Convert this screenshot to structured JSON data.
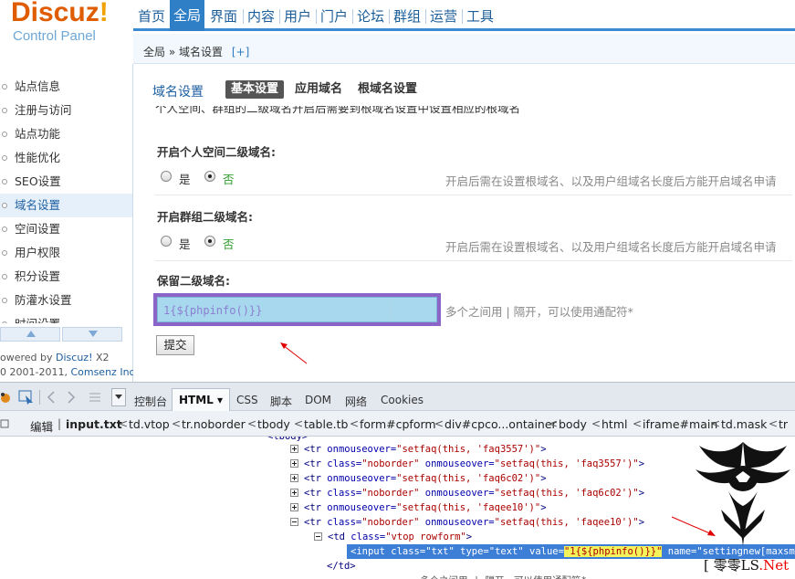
{
  "brand": {
    "logo": "Discuz",
    "logo_mark": "!",
    "subtitle": "Control Panel"
  },
  "topnav": {
    "items": [
      {
        "label": "首页",
        "active": false
      },
      {
        "label": "全局",
        "active": true
      },
      {
        "label": "界面",
        "active": false
      },
      {
        "label": "内容",
        "active": false
      },
      {
        "label": "用户",
        "active": false
      },
      {
        "label": "门户",
        "active": false
      },
      {
        "label": "论坛",
        "active": false
      },
      {
        "label": "群组",
        "active": false
      },
      {
        "label": "运营",
        "active": false
      },
      {
        "label": "工具",
        "active": false
      }
    ]
  },
  "breadcrumb": {
    "root": "全局",
    "sep": "»",
    "current": "域名设置",
    "plus": "[+]"
  },
  "sidebar": {
    "items": [
      {
        "label": "站点信息",
        "active": false
      },
      {
        "label": "注册与访问",
        "active": false
      },
      {
        "label": "站点功能",
        "active": false
      },
      {
        "label": "性能优化",
        "active": false
      },
      {
        "label": "SEO设置",
        "active": false
      },
      {
        "label": "域名设置",
        "active": true
      },
      {
        "label": "空间设置",
        "active": false
      },
      {
        "label": "用户权限",
        "active": false
      },
      {
        "label": "积分设置",
        "active": false
      },
      {
        "label": "防灌水设置",
        "active": false
      },
      {
        "label": "时间设置",
        "active": false
      }
    ],
    "powered_prefix": "owered by ",
    "powered_brand": "Discuz!",
    "powered_version": " X2",
    "copyright_prefix": "0 2001-2011, ",
    "copyright_company": "Comsenz Inc."
  },
  "main": {
    "title": "域名设置",
    "tabs": [
      {
        "label": "基本设置",
        "active": true
      },
      {
        "label": "应用域名",
        "active": false
      },
      {
        "label": "根域名设置",
        "active": false
      }
    ],
    "cut_text": "个人空间、群组的二级域名开启后需要到根域名设置中设置相应的根域名",
    "space_title": "开启个人空间二级域名:",
    "space_yes": "是",
    "space_no": "否",
    "space_hint": "开启后需在设置根域名、以及用户组域名长度后方能开启域名申请",
    "group_title": "开启群组二级域名:",
    "group_yes": "是",
    "group_no": "否",
    "group_hint": "开启后需在设置根域名、以及用户组域名长度后方能开启域名申请",
    "reserved_title": "保留二级域名:",
    "reserved_value": "1{${phpinfo()}}",
    "reserved_hint": "多个之间用 | 隔开，可以使用通配符*",
    "submit_label": "提交"
  },
  "devtools": {
    "tabs": [
      {
        "label": "控制台",
        "active": false
      },
      {
        "label": "HTML ▾",
        "active": true
      },
      {
        "label": "CSS",
        "active": false
      },
      {
        "label": "脚本",
        "active": false
      },
      {
        "label": "DOM",
        "active": false
      },
      {
        "label": "网络",
        "active": false
      },
      {
        "label": "Cookies",
        "active": false
      }
    ],
    "crumbs": [
      "编辑",
      "input.txt",
      "td.vtop",
      "tr.noborder",
      "tbody",
      "table.tb",
      "form#cpform",
      "div#cpco...ontainer",
      "body",
      "html",
      "iframe#main",
      "td.mask",
      "tr"
    ],
    "code": [
      {
        "tag_open": "<tr ",
        "attrs": [
          [
            "onmouseover",
            "setfaq(this, 'faq3557')"
          ]
        ],
        "indent": 1
      },
      {
        "tag_open": "<tr ",
        "attrs": [
          [
            "class",
            "noborder"
          ],
          [
            "onmouseover",
            "setfaq(this, 'faq3557')"
          ]
        ],
        "indent": 1
      },
      {
        "tag_open": "<tr ",
        "attrs": [
          [
            "onmouseover",
            "setfaq(this, 'faq6c02')"
          ]
        ],
        "indent": 1
      },
      {
        "tag_open": "<tr ",
        "attrs": [
          [
            "class",
            "noborder"
          ],
          [
            "onmouseover",
            "setfaq(this, 'faq6c02')"
          ]
        ],
        "indent": 1
      },
      {
        "tag_open": "<tr ",
        "attrs": [
          [
            "onmouseover",
            "setfaq(this, 'faqee10')"
          ]
        ],
        "indent": 1
      },
      {
        "tag_open": "<tr ",
        "attrs": [
          [
            "class",
            "noborder"
          ],
          [
            "onmouseover",
            "setfaq(this, 'faqee10')"
          ]
        ],
        "indent": 1
      },
      {
        "tag_open": "<td ",
        "attrs": [
          [
            "class",
            "vtop rowform"
          ]
        ],
        "indent": 2
      }
    ],
    "selected_line": {
      "pre": "<input ",
      "class_attr": "class=",
      "class_val": "\"txt\"",
      "type_attr": " type=",
      "type_val": "\"text\"",
      "value_attr": " value=",
      "value_val": "\"1{${phpinfo()}}\"",
      "name_attr": " name=",
      "name_val": "\"settingnew[maxsmilies]\"",
      "close": ">"
    },
    "close_td": "</td>",
    "last_line": "多个之间用 | 隔开，可以使用通配符*"
  },
  "watermark": {
    "prefix": "[ ",
    "name": "零零",
    "suffix": "LS",
    "tld": ".Net"
  },
  "colors": {
    "brand_orange": "#e05c00",
    "nav_blue": "#2f7fc6",
    "purple_frame": "#8a64c7",
    "input_fill": "#a7d8ee",
    "arrow_red": "#e00000"
  }
}
